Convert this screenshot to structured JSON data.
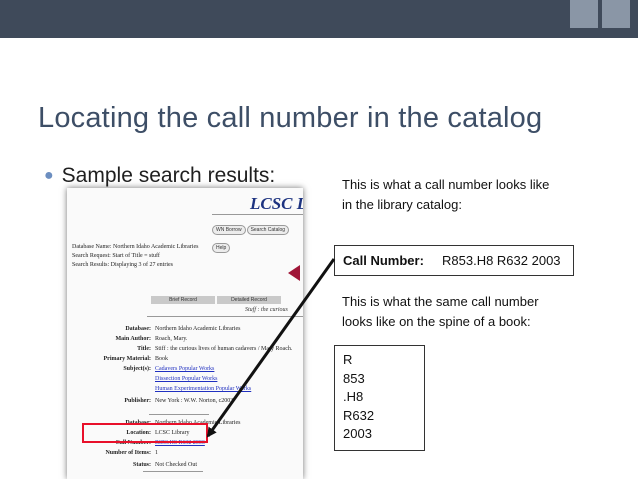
{
  "slide": {
    "title": "Locating the call number in the catalog",
    "bullet": "Sample search results:",
    "callout_top": [
      "This is what a call number looks like",
      "in the library catalog:"
    ],
    "call_number_label": "Call Number:",
    "call_number_value": "R853.H8 R632 2003",
    "callout_mid": [
      "This is what the same call number",
      "looks like on the spine of a book:"
    ],
    "spine_lines": [
      "R",
      "853",
      ".H8",
      "R632",
      "2003"
    ]
  },
  "catalog": {
    "logo": "LCSC L",
    "nav_buttons": [
      "WN Borrow",
      "Search Catalog",
      "Help"
    ],
    "meta": [
      "Database Name: Northern Idaho Academic Libraries",
      "Search Request: Start of Title = stuff",
      "Search Results: Displaying 3 of 27 entries"
    ],
    "tabs": [
      "Brief Record",
      "Detailed Record"
    ],
    "subtitle": "Stuff : the curious",
    "rows": [
      {
        "label": "Database:",
        "value": "Northern Idaho Academic Libraries"
      },
      {
        "label": "Main Author:",
        "value": "Roach, Mary."
      },
      {
        "label": "Title:",
        "value": "Stiff : the curious lives of human cadavers / Mary Roach."
      },
      {
        "label": "Primary Material:",
        "value": "Book"
      },
      {
        "label": "Subject(s):",
        "value": "Cadavers Popular Works"
      },
      {
        "label": "",
        "value": "Dissection Popular Works"
      },
      {
        "label": "",
        "value": "Human Experimentation Popular Works"
      },
      {
        "label": "Publisher:",
        "value": "New York : W.W. Norton, c2003"
      },
      {
        "label": "Database:",
        "value": "Northern Idaho Academic Libraries"
      },
      {
        "label": "Location:",
        "value": "LCSC Library"
      },
      {
        "label": "Call Number:",
        "value": "R853.H8 R632 2003"
      },
      {
        "label": "Number of Items:",
        "value": "1"
      },
      {
        "label": "Status:",
        "value": "Not Checked Out"
      }
    ]
  },
  "colors": {
    "title": "#3d4e66",
    "bullet_dot": "#6c8ec0",
    "highlight_box": "#e8102a",
    "top_bar": "#3f4a5a"
  }
}
